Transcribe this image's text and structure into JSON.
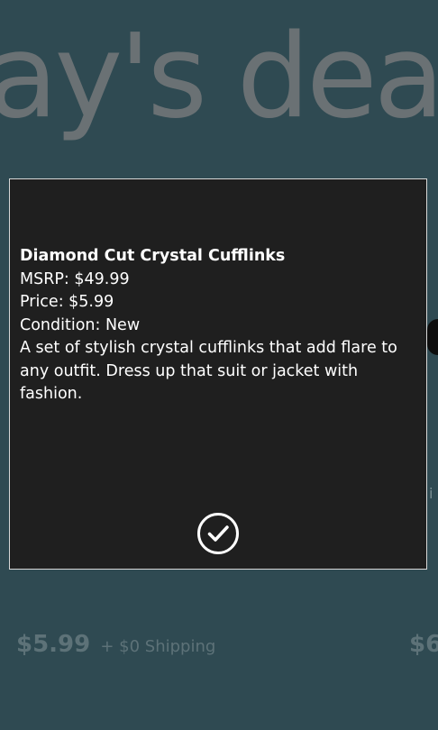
{
  "background": {
    "title": "ay's dea",
    "price": "$5.99",
    "shipping": "+ $0 Shipping",
    "price_right": "$6"
  },
  "dialog": {
    "product_name": "Diamond Cut Crystal Cufflinks",
    "msrp": "MSRP: $49.99",
    "price": "Price: $5.99",
    "condition": "Condition: New",
    "description": "A set of stylish crystal cufflinks that add flare to any outfit. Dress up that suit or jacket with fashion.",
    "confirm_icon": "check-circle-icon"
  },
  "colors": {
    "background": "#2f4a52",
    "dialog_background": "#1f1f1f",
    "dialog_border": "#d8d8d8",
    "text": "#ffffff",
    "faded_title": "#6a7174",
    "faded_price": "#5d7278"
  }
}
